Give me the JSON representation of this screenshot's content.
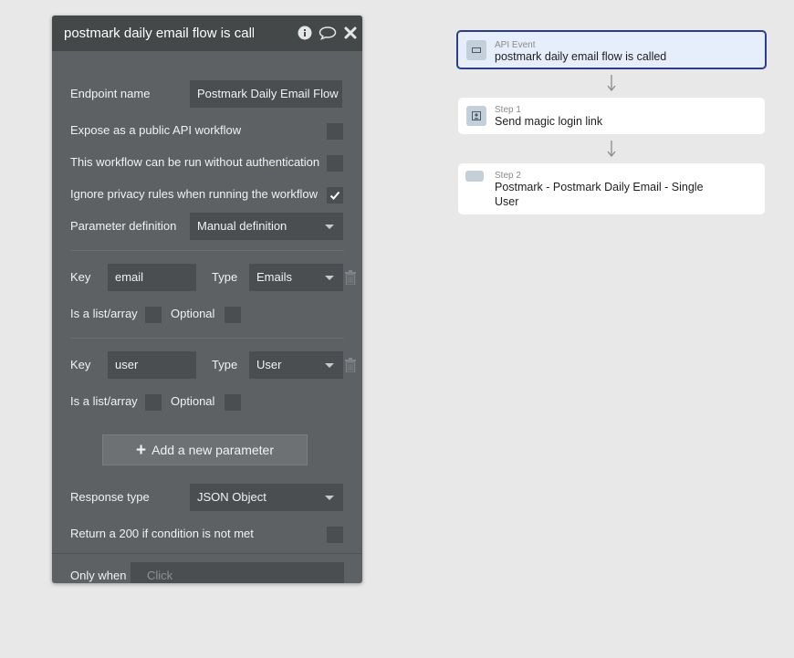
{
  "panel": {
    "title": "postmark daily email flow is called",
    "header_icons": [
      "info-icon",
      "comment-icon",
      "close-icon"
    ],
    "endpoint_name": {
      "label": "Endpoint name",
      "value": "Postmark Daily Email Flow"
    },
    "expose_public": {
      "label": "Expose as a public API workflow",
      "checked": false
    },
    "run_without_auth": {
      "label": "This workflow can be run without authentication",
      "checked": false
    },
    "ignore_privacy": {
      "label": "Ignore privacy rules when running the workflow",
      "checked": true
    },
    "parameter_definition": {
      "label": "Parameter definition",
      "value": "Manual definition"
    },
    "parameters": [
      {
        "key_label": "Key",
        "key": "email",
        "type_label": "Type",
        "type": "Emails",
        "list_label": "Is a list/array",
        "is_list": false,
        "optional_label": "Optional",
        "optional": false
      },
      {
        "key_label": "Key",
        "key": "user",
        "type_label": "Type",
        "type": "User",
        "list_label": "Is a list/array",
        "is_list": false,
        "optional_label": "Optional",
        "optional": false
      }
    ],
    "add_parameter_label": "Add a new parameter",
    "response_type": {
      "label": "Response type",
      "value": "JSON Object"
    },
    "return_200": {
      "label": "Return a 200 if condition is not met",
      "checked": false
    },
    "only_when": {
      "label": "Only when",
      "placeholder": "Click"
    }
  },
  "workflow": {
    "event": {
      "step": "API Event",
      "name": "postmark daily email flow is called"
    },
    "steps": [
      {
        "step": "Step 1",
        "name": "Send magic login link"
      },
      {
        "step": "Step 2",
        "name": "Postmark - Postmark Daily Email - Single User"
      }
    ]
  },
  "colors": {
    "canvas_bg": "#e8e8e8",
    "panel_bg": "#5d6163",
    "panel_header_bg": "#444849",
    "active_card_border": "#2e3d8a",
    "active_card_bg": "#e6eefb"
  }
}
